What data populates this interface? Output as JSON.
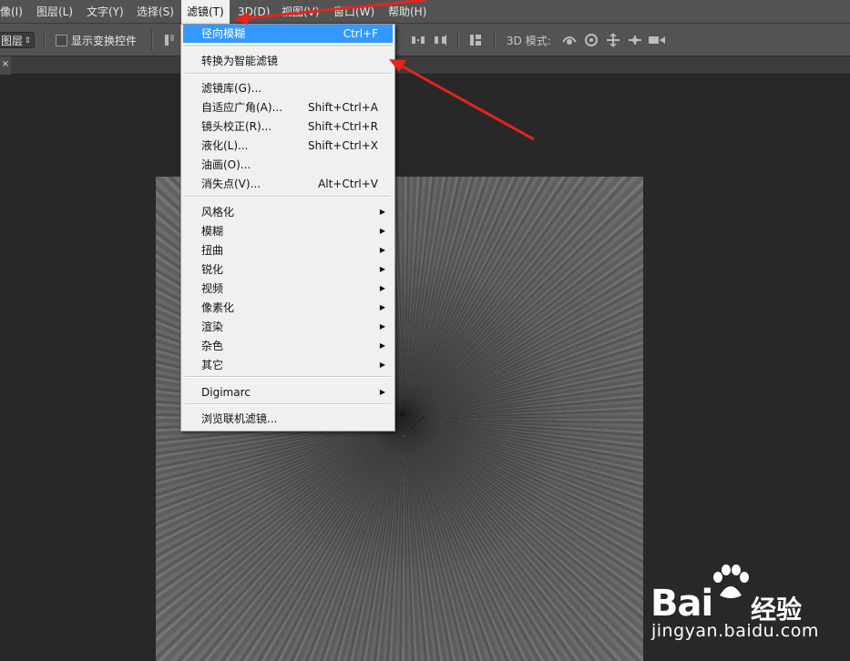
{
  "menubar": {
    "items": [
      "像(I)",
      "图层(L)",
      "文字(Y)",
      "选择(S)",
      "滤镜(T)",
      "3D(D)",
      "视图(V)",
      "窗口(W)",
      "帮助(H)"
    ]
  },
  "options": {
    "layer_select": "图层",
    "show_transform_label": "显示变换控件",
    "mode_3d_label": "3D 模式:"
  },
  "tab": {
    "close": "×"
  },
  "filter_menu": {
    "items": [
      {
        "label": "径向模糊",
        "shortcut": "Ctrl+F",
        "highlighted": true
      },
      {
        "label": "转换为智能滤镜",
        "shortcut": ""
      },
      {
        "label": "滤镜库(G)...",
        "shortcut": ""
      },
      {
        "label": "自适应广角(A)...",
        "shortcut": "Shift+Ctrl+A"
      },
      {
        "label": "镜头校正(R)...",
        "shortcut": "Shift+Ctrl+R"
      },
      {
        "label": "液化(L)...",
        "shortcut": "Shift+Ctrl+X"
      },
      {
        "label": "油画(O)...",
        "shortcut": ""
      },
      {
        "label": "消失点(V)...",
        "shortcut": "Alt+Ctrl+V"
      },
      {
        "label": "风格化",
        "submenu": true
      },
      {
        "label": "模糊",
        "submenu": true
      },
      {
        "label": "扭曲",
        "submenu": true
      },
      {
        "label": "锐化",
        "submenu": true
      },
      {
        "label": "视频",
        "submenu": true
      },
      {
        "label": "像素化",
        "submenu": true
      },
      {
        "label": "渲染",
        "submenu": true
      },
      {
        "label": "杂色",
        "submenu": true
      },
      {
        "label": "其它",
        "submenu": true
      },
      {
        "label": "Digimarc",
        "submenu": true
      },
      {
        "label": "浏览联机滤镜..."
      }
    ],
    "submenu_arrow": "▶"
  },
  "watermark": {
    "logo_text": "Bai",
    "logo_suffix": "经验",
    "url": "jingyan.baidu.com"
  },
  "colors": {
    "highlight": "#3399ff",
    "annotation_arrow": "#e8231f"
  }
}
